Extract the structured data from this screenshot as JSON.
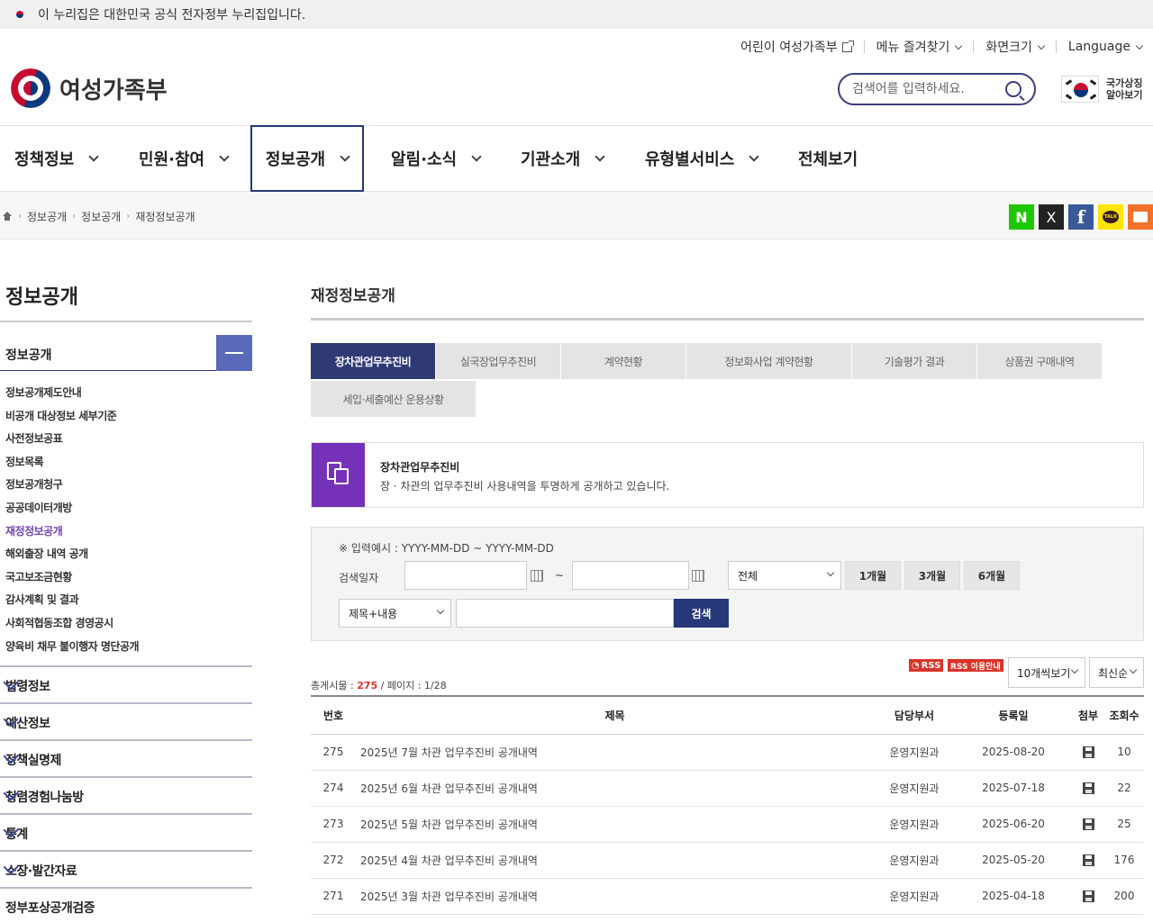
{
  "banner": {
    "text": "이 누리집은 대한민국 공식 전자정부 누리집입니다."
  },
  "util": {
    "kids": "어린이 여성가족부",
    "favorites": "메뉴 즐겨찾기",
    "screen_size": "화면크기",
    "language": "Language"
  },
  "logo": {
    "text": "여성가족부"
  },
  "search": {
    "placeholder": "검색어를 입력하세요."
  },
  "national": {
    "line1": "국가상징",
    "line2": "알아보기"
  },
  "gnb": [
    {
      "label": "정책정보"
    },
    {
      "label": "민원·참여"
    },
    {
      "label": "정보공개"
    },
    {
      "label": "알림·소식"
    },
    {
      "label": "기관소개"
    },
    {
      "label": "유형별서비스"
    },
    {
      "label": "전체보기"
    }
  ],
  "breadcrumb": [
    "정보공개",
    "정보공개",
    "재정정보공개"
  ],
  "share": {
    "naver": "N",
    "x": "X",
    "facebook": "f",
    "kakao": "TALK"
  },
  "sidebar": {
    "title": "정보공개",
    "section": "정보공개",
    "items": [
      "정보공개제도안내",
      "비공개 대상정보 세부기준",
      "사전정보공표",
      "정보목록",
      "정보공개청구",
      "공공데이터개방",
      "재정정보공개",
      "해외출장 내역 공개",
      "국고보조금현황",
      "감사계획 및 결과",
      "사회적협동조합 경영공시",
      "양육비 채무 불이행자 명단공개"
    ],
    "categories": [
      "법령정보",
      "예산정보",
      "정책실명제",
      "청렴경험나눔방",
      "통계",
      "소장·발간자료",
      "정부포상공개검증"
    ]
  },
  "content": {
    "title": "재정정보공개",
    "tabs": [
      "장차관업무추진비",
      "실국장업무추진비",
      "계약현황",
      "정보화사업 계약현황",
      "기술평가 결과",
      "상품권 구매내역",
      "세입·세출예산 운용상황"
    ],
    "info_title": "장차관업무추진비",
    "info_desc": "장 · 차관의 업무추진비 사용내역을 투명하게 공개하고 있습니다."
  },
  "search_form": {
    "hint": "※ 입력예시 : YYYY-MM-DD ~ YYYY-MM-DD",
    "date_label": "검색일자",
    "tilde": "~",
    "period_select": "전체",
    "btn_1m": "1개월",
    "btn_3m": "3개월",
    "btn_6m": "6개월",
    "field_select": "제목+내용",
    "search_btn": "검색"
  },
  "list": {
    "rss": "RSS",
    "rss_guide": "RSS 이용안내",
    "total_label": "총게시물 : ",
    "total": "275",
    "page_info": " / 페이지 : 1/28",
    "per_page": "10개씩보기",
    "sort": "최신순",
    "headers": [
      "번호",
      "제목",
      "담당부서",
      "등록일",
      "첨부",
      "조회수"
    ],
    "rows": [
      {
        "no": "275",
        "title": "2025년 7월 차관 업무추진비 공개내역",
        "dept": "운영지원과",
        "date": "2025-08-20",
        "views": "10"
      },
      {
        "no": "274",
        "title": "2025년 6월 차관 업무추진비 공개내역",
        "dept": "운영지원과",
        "date": "2025-07-18",
        "views": "22"
      },
      {
        "no": "273",
        "title": "2025년 5월 차관 업무추진비 공개내역",
        "dept": "운영지원과",
        "date": "2025-06-20",
        "views": "25"
      },
      {
        "no": "272",
        "title": "2025년 4월 차관 업무추진비 공개내역",
        "dept": "운영지원과",
        "date": "2025-05-20",
        "views": "176"
      },
      {
        "no": "271",
        "title": "2025년 3월 차관 업무추진비 공개내역",
        "dept": "운영지원과",
        "date": "2025-04-18",
        "views": "200"
      }
    ]
  }
}
